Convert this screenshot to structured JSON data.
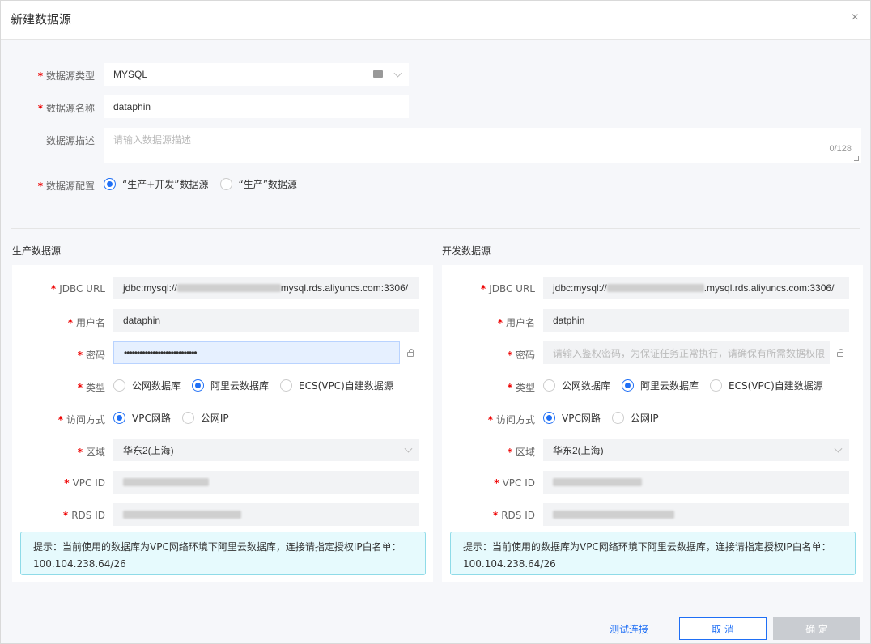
{
  "dialog": {
    "title": "新建数据源",
    "close": "×"
  },
  "form": {
    "type_label": "数据源类型",
    "type_value": "MYSQL",
    "name_label": "数据源名称",
    "name_value": "dataphin",
    "desc_label": "数据源描述",
    "desc_placeholder": "请输入数据源描述",
    "desc_counter": "0/128",
    "config_label": "数据源配置",
    "config_options": [
      "“生产+开发”数据源",
      "“生产”数据源"
    ],
    "config_selected": 0
  },
  "prod": {
    "section_title": "生产数据源",
    "jdbc_label": "JDBC URL",
    "jdbc_prefix": "jdbc:mysql://",
    "jdbc_suffix": "mysql.rds.aliyuncs.com:3306/",
    "user_label": "用户名",
    "user_value": "dataphin",
    "pwd_label": "密码",
    "pwd_value": "••••••••••••••••••••••••••••",
    "type_label": "类型",
    "type_options": [
      "公网数据库",
      "阿里云数据库",
      "ECS(VPC)自建数据源"
    ],
    "type_selected": 1,
    "access_label": "访问方式",
    "access_options": [
      "VPC网路",
      "公网IP"
    ],
    "access_selected": 0,
    "region_label": "区域",
    "region_value": "华东2(上海)",
    "vpc_label": "VPC ID",
    "rds_label": "RDS ID",
    "tip_line1": "提示：当前使用的数据库为VPC网络环境下阿里云数据库，连接请指定授权IP白名单：",
    "tip_line2": "100.104.238.64/26"
  },
  "dev": {
    "section_title": "开发数据源",
    "jdbc_label": "JDBC URL",
    "jdbc_prefix": "jdbc:mysql://",
    "jdbc_suffix": ".mysql.rds.aliyuncs.com:3306/",
    "user_label": "用户名",
    "user_value": "datphin",
    "pwd_label": "密码",
    "pwd_placeholder": "请输入鉴权密码，为保证任务正常执行，请确保有所需数据权限",
    "type_label": "类型",
    "type_options": [
      "公网数据库",
      "阿里云数据库",
      "ECS(VPC)自建数据源"
    ],
    "type_selected": 1,
    "access_label": "访问方式",
    "access_options": [
      "VPC网路",
      "公网IP"
    ],
    "access_selected": 0,
    "region_label": "区域",
    "region_value": "华东2(上海)",
    "vpc_label": "VPC ID",
    "rds_label": "RDS ID",
    "tip_line1": "提示：当前使用的数据库为VPC网络环境下阿里云数据库，连接请指定授权IP白名单：",
    "tip_line2": "100.104.238.64/26"
  },
  "footer": {
    "test_label": "测试连接",
    "cancel_label": "取 消",
    "ok_label": "确 定"
  },
  "colors": {
    "primary": "#1f6ff5",
    "required": "#ee0000",
    "tip_bg": "#e6fafd",
    "disabled": "#c9ccd1"
  }
}
